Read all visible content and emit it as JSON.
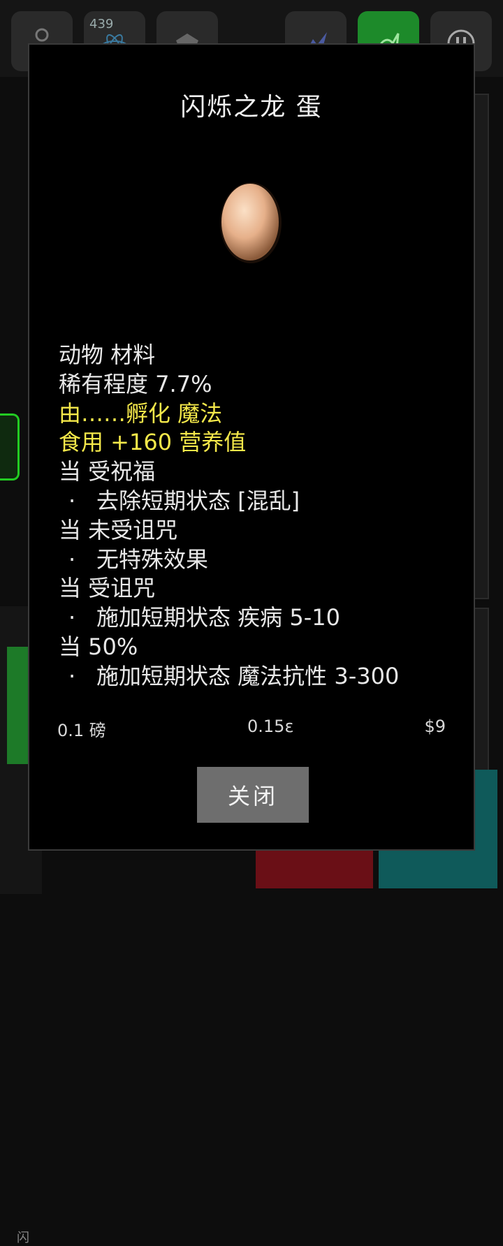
{
  "background": {
    "topbar": {
      "counter_badge": "439"
    },
    "left_panel": {
      "label": "闪"
    }
  },
  "modal": {
    "title": "闪烁之龙 蛋",
    "info_lines": {
      "category": "动物 材料",
      "rarity": "稀有程度 7.7%",
      "hatch": "由……孵化 魔法",
      "eat": "食用 +160 营养值",
      "blessed_label": "当 受祝福",
      "blessed_effect": "去除短期状态 [混乱]",
      "uncursed_label": "当 未受诅咒",
      "uncursed_effect": "无特殊效果",
      "cursed_label": "当 受诅咒",
      "cursed_effect": "施加短期状态 疾病 5-10",
      "chance_label": "当 50%",
      "chance_effect": "施加短期状态 魔法抗性 3-300",
      "bullet": "·"
    },
    "stats": {
      "weight": "0.1 磅",
      "energy": "0.15ε",
      "price": "$9"
    },
    "close_label": "关闭"
  },
  "colors": {
    "highlight_yellow": "#f4e84a",
    "modal_bg": "#000000",
    "button_gray": "#6e6e6e"
  }
}
